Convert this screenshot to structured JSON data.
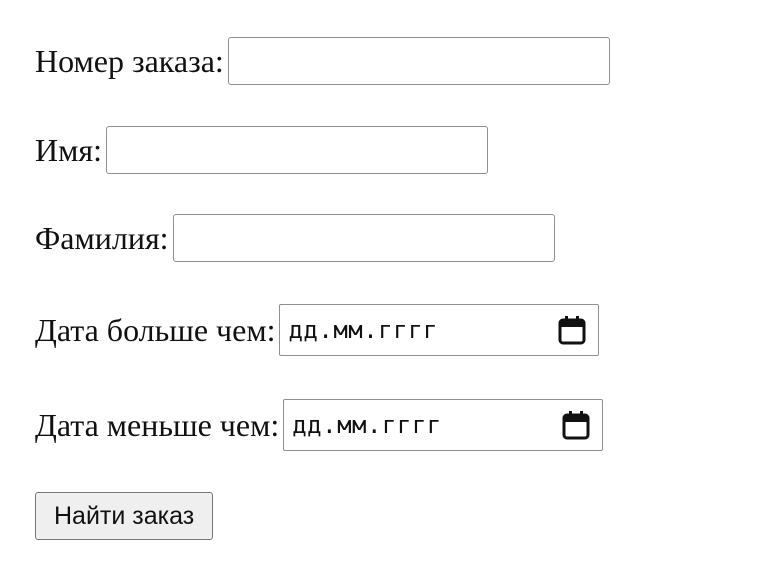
{
  "form": {
    "fields": {
      "order_number": {
        "label": "Номер заказа:",
        "value": ""
      },
      "first_name": {
        "label": "Имя:",
        "value": ""
      },
      "last_name": {
        "label": "Фамилия:",
        "value": ""
      },
      "date_from": {
        "label": "Дата больше чем:",
        "placeholder": "дд.мм.гггг"
      },
      "date_to": {
        "label": "Дата меньше чем:",
        "placeholder": "дд.мм.гггг"
      }
    },
    "submit_label": "Найти заказ"
  },
  "icons": {
    "calendar": "calendar-icon"
  }
}
